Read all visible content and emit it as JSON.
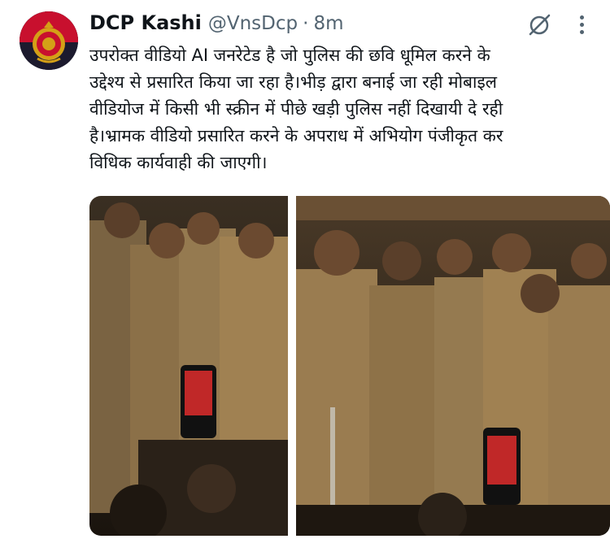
{
  "tweet": {
    "author_name": "DCP Kashi",
    "handle": "@VnsDcp",
    "separator": "·",
    "time": "8m",
    "text": "उपरोक्त वीडियो AI जनरेटेड है जो पुलिस की छवि धूमिल करने के\nउद्देश्य से प्रसारित किया जा रहा है।भीड़ द्वारा बनाई जा रही मोबाइल\nवीडियोज में किसी भी स्क्रीन में पीछे खड़ी पुलिस नहीं दिखायी दे रही\nहै।भ्रामक वीडियो प्रसारित करने के अपराध में अभियोग पंजीकृत कर\nविधिक कार्यवाही की जाएगी।"
  },
  "icons": {
    "grok": "grok-icon",
    "more": "more-options-icon",
    "avatar": "police-emblem"
  },
  "colors": {
    "text": "#0f1419",
    "secondary": "#536471",
    "avatar_bg": "#1c1a2e",
    "emblem_red": "#c8102e",
    "uniform_khaki": "#a08152"
  }
}
